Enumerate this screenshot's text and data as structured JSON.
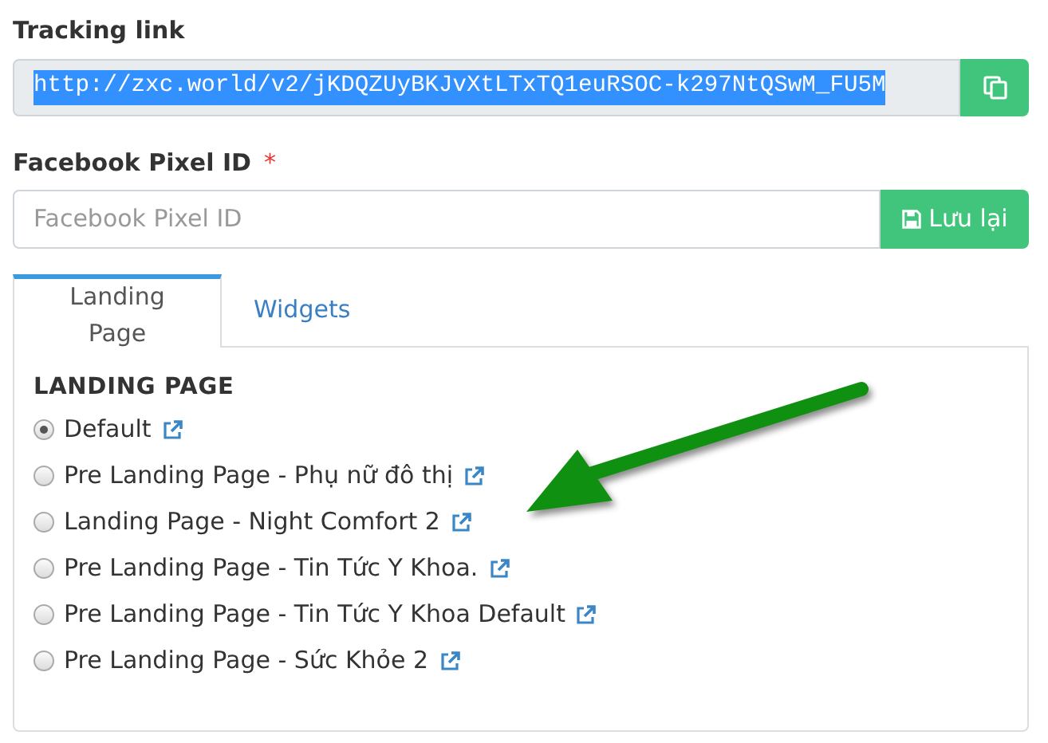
{
  "tracking_link": {
    "label": "Tracking link",
    "value": "http://zxc.world/v2/jKDQZUyBKJvXtLTxTQ1euRSOC-k297NtQSwM_FU5M",
    "selected_text": true
  },
  "pixel": {
    "label": "Facebook Pixel ID",
    "required_mark": "*",
    "placeholder": "Facebook Pixel ID",
    "button": "Lưu lại"
  },
  "tabs": [
    {
      "label": "Landing Page",
      "selected": true
    },
    {
      "label": "Widgets",
      "selected": false
    }
  ],
  "section_title": "LANDING PAGE",
  "options": [
    {
      "label": "Default",
      "selected": true
    },
    {
      "label": "Pre Landing Page - Phụ nữ đô thị",
      "selected": false
    },
    {
      "label": "Landing Page - Night Comfort 2",
      "selected": false
    },
    {
      "label": "Pre Landing Page - Tin Tức Y Khoa.",
      "selected": false
    },
    {
      "label": "Pre Landing Page - Tin Tức Y Khoa Default",
      "selected": false
    },
    {
      "label": "Pre Landing Page - Sức Khỏe 2",
      "selected": false
    }
  ]
}
